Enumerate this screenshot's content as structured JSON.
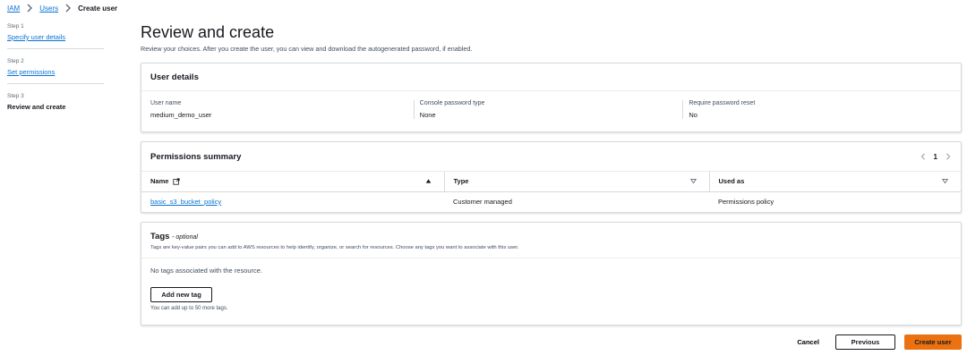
{
  "breadcrumb": {
    "items": [
      "IAM",
      "Users"
    ],
    "current": "Create user"
  },
  "steps": [
    {
      "num": "Step 1",
      "title": "Specify user details"
    },
    {
      "num": "Step 2",
      "title": "Set permissions"
    },
    {
      "num": "Step 3",
      "title": "Review and create"
    }
  ],
  "page": {
    "title": "Review and create",
    "description": "Review your choices. After you create the user, you can view and download the autogenerated password, if enabled."
  },
  "user_details": {
    "title": "User details",
    "fields": [
      {
        "label": "User name",
        "value": "medium_demo_user"
      },
      {
        "label": "Console password type",
        "value": "None"
      },
      {
        "label": "Require password reset",
        "value": "No"
      }
    ]
  },
  "permissions": {
    "title": "Permissions summary",
    "page": "1",
    "columns": [
      "Name",
      "Type",
      "Used as"
    ],
    "rows": [
      {
        "name": "basic_s3_bucket_policy",
        "type": "Customer managed",
        "used_as": "Permissions policy"
      }
    ]
  },
  "tags": {
    "title": "Tags",
    "optional": "- optional",
    "description": "Tags are key-value pairs you can add to AWS resources to help identify, organize, or search for resources. Choose any tags you want to associate with this user.",
    "empty": "No tags associated with the resource.",
    "add_label": "Add new tag",
    "note": "You can add up to 50 more tags."
  },
  "footer": {
    "cancel": "Cancel",
    "previous": "Previous",
    "create": "Create user"
  },
  "colors": {
    "primary": "#ec7211",
    "link": "#0972d3"
  }
}
